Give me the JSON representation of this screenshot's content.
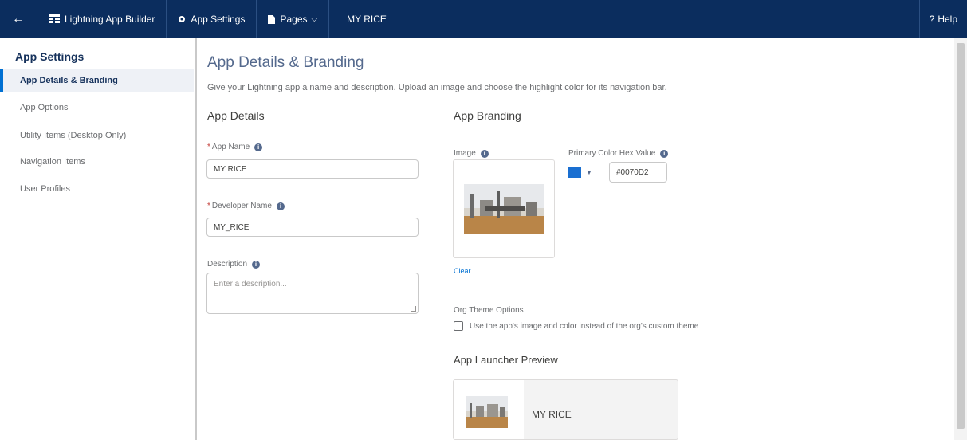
{
  "topbar": {
    "back_icon": "back-arrow-icon",
    "builder_label": "Lightning App Builder",
    "settings_label": "App Settings",
    "pages_label": "Pages",
    "app_name": "MY RICE",
    "help_label": "Help",
    "help_icon": "?"
  },
  "sidebar": {
    "title": "App Settings",
    "items": [
      {
        "label": "App Details & Branding",
        "active": true
      },
      {
        "label": "App Options"
      },
      {
        "label": "Utility Items (Desktop Only)"
      },
      {
        "label": "Navigation Items"
      },
      {
        "label": "User Profiles"
      }
    ]
  },
  "main": {
    "title": "App Details & Branding",
    "subtitle": "Give your Lightning app a name and description. Upload an image and choose the highlight color for its navigation bar.",
    "details": {
      "heading": "App Details",
      "app_name_label": "App Name",
      "app_name_value": "MY RICE",
      "dev_name_label": "Developer Name",
      "dev_name_value": "MY_RICE",
      "description_label": "Description",
      "description_placeholder": "Enter a description..."
    },
    "branding": {
      "heading": "App Branding",
      "image_label": "Image",
      "clear_label": "Clear",
      "color_label": "Primary Color Hex Value",
      "color_value": "#0070D2",
      "swatch_color": "#1a6fd1",
      "theme_label": "Org Theme Options",
      "theme_checkbox_label": "Use the app's image and color instead of the org's custom theme",
      "theme_checked": false,
      "preview_heading": "App Launcher Preview",
      "preview_app_name": "MY RICE"
    }
  }
}
